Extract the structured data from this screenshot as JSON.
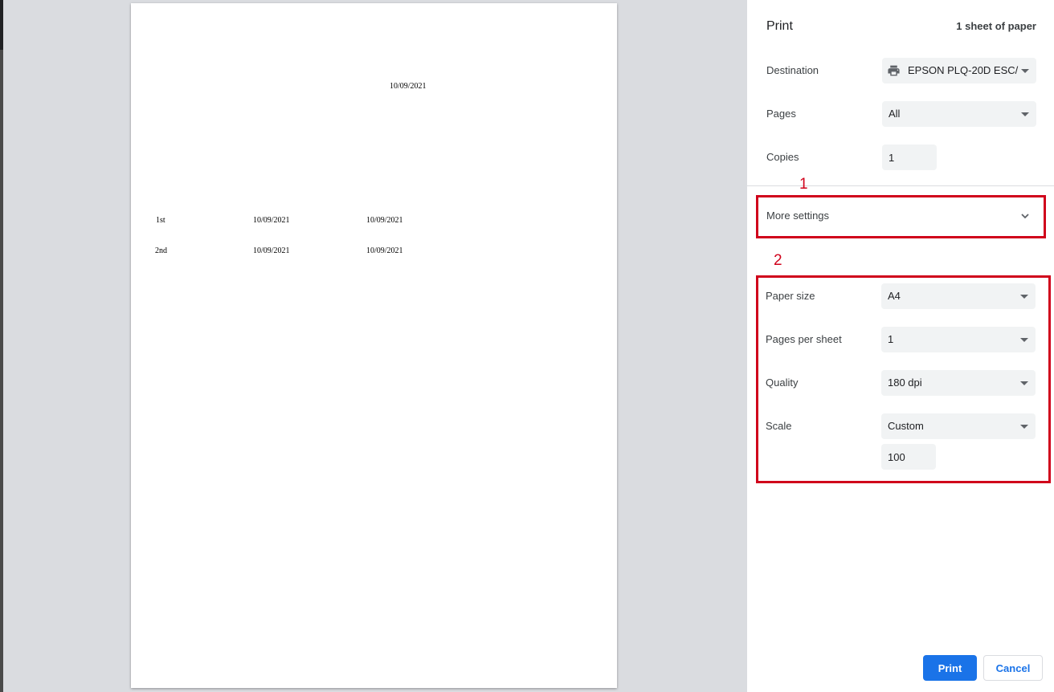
{
  "preview": {
    "header_date": "10/09/2021",
    "rows": [
      {
        "label": "1st",
        "date1": "10/09/2021",
        "date2": "10/09/2021"
      },
      {
        "label": "2nd",
        "date1": "10/09/2021",
        "date2": "10/09/2021"
      }
    ]
  },
  "panel": {
    "title": "Print",
    "sheet_count": "1 sheet of paper",
    "destination": {
      "label": "Destination",
      "value": "EPSON PLQ-20D ESC/",
      "icon": "printer-icon"
    },
    "pages": {
      "label": "Pages",
      "value": "All"
    },
    "copies": {
      "label": "Copies",
      "value": "1"
    },
    "more_settings": {
      "label": "More settings",
      "icon": "chevron-down-icon"
    },
    "paper_size": {
      "label": "Paper size",
      "value": "A4"
    },
    "pages_per_sheet": {
      "label": "Pages per sheet",
      "value": "1"
    },
    "quality": {
      "label": "Quality",
      "value": "180 dpi"
    },
    "scale": {
      "label": "Scale",
      "value": "Custom",
      "custom_value": "100"
    },
    "print_label": "Print",
    "cancel_label": "Cancel"
  },
  "annotations": {
    "marker_1": "1",
    "marker_2": "2",
    "color": "#d0021b"
  },
  "colors": {
    "accent": "#1a73e8",
    "preview_background": "#dadce0",
    "field_background": "#f1f3f4"
  }
}
